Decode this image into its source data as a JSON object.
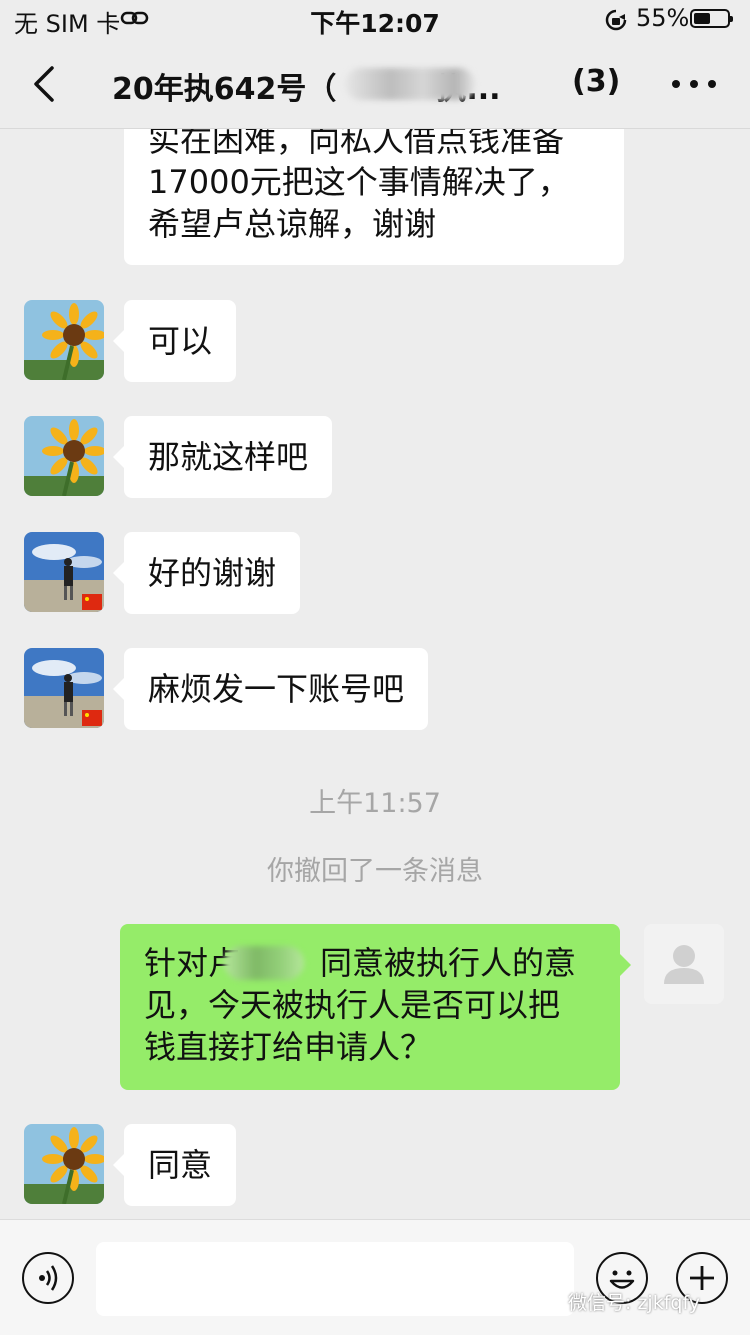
{
  "status_bar": {
    "carrier": "无 SIM 卡",
    "time": "下午12:07",
    "battery_percent": "55%",
    "battery_level": 0.55
  },
  "nav": {
    "title_prefix": "20年执642号（",
    "title_suffix": "执...",
    "member_count": "(3)"
  },
  "messages": [
    {
      "id": "m1",
      "side": "left",
      "text_lines": [
        "实在困难，向私人借点钱准备",
        "17000元把这个事情解决了，",
        "希望卢总谅解，谢谢"
      ]
    },
    {
      "id": "m2",
      "side": "left",
      "avatar": "sunflower-avatar",
      "text": "可以"
    },
    {
      "id": "m3",
      "side": "left",
      "avatar": "sunflower-avatar",
      "text": "那就这样吧"
    },
    {
      "id": "m4",
      "side": "left",
      "avatar": "person-avatar",
      "text": "好的谢谢"
    },
    {
      "id": "m5",
      "side": "left",
      "avatar": "person-avatar",
      "text": "麻烦发一下账号吧"
    },
    {
      "id": "m7",
      "side": "right",
      "avatar": "default-avatar",
      "text_lines": [
        "针对卢",
        "同意被执行人的意",
        "见，今天被执行人是否可以把",
        "钱直接打给申请人？"
      ]
    },
    {
      "id": "m8",
      "side": "left",
      "avatar": "sunflower-avatar",
      "text": "同意"
    }
  ],
  "timestamp": "上午11:57",
  "recall_notice": "你撤回了一条消息",
  "input": {
    "placeholder": "",
    "value": ""
  },
  "watermark": "微信号: zjkfqfy",
  "colors": {
    "background": "#ededed",
    "bubble_self": "#95ec69",
    "bubble_other": "#ffffff"
  }
}
